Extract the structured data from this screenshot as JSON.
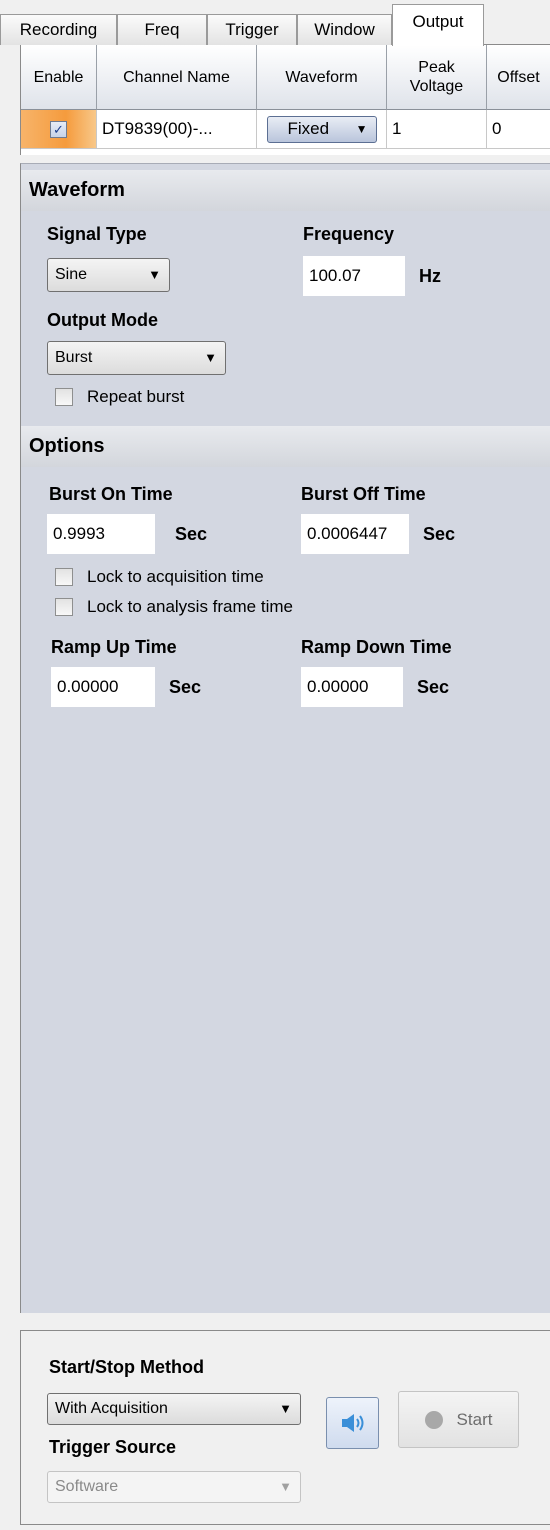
{
  "tabs": [
    {
      "label": "Recording"
    },
    {
      "label": "Freq"
    },
    {
      "label": "Trigger"
    },
    {
      "label": "Window"
    },
    {
      "label": "Output"
    }
  ],
  "grid": {
    "headers": {
      "enable": "Enable",
      "channel_name": "Channel Name",
      "waveform": "Waveform",
      "peak_voltage": "Peak Voltage",
      "offset": "Offset"
    },
    "row": {
      "enabled": true,
      "channel_name": "DT9839(00)-...",
      "waveform": "Fixed",
      "peak_voltage": "1",
      "offset": "0"
    }
  },
  "waveform_section": {
    "title": "Waveform",
    "signal_type_label": "Signal Type",
    "signal_type_value": "Sine",
    "frequency_label": "Frequency",
    "frequency_value": "100.07",
    "frequency_unit": "Hz",
    "output_mode_label": "Output Mode",
    "output_mode_value": "Burst",
    "repeat_burst_label": "Repeat burst"
  },
  "options_section": {
    "title": "Options",
    "burst_on_label": "Burst On Time",
    "burst_on_value": "0.9993",
    "burst_off_label": "Burst Off Time",
    "burst_off_value": "0.0006447",
    "sec_unit": "Sec",
    "lock_acq_label": "Lock to acquisition time",
    "lock_frame_label": "Lock to analysis frame time",
    "ramp_up_label": "Ramp Up Time",
    "ramp_up_value": "0.00000",
    "ramp_down_label": "Ramp Down Time",
    "ramp_down_value": "0.00000"
  },
  "bottom": {
    "start_stop_label": "Start/Stop Method",
    "start_stop_value": "With Acquisition",
    "trigger_source_label": "Trigger Source",
    "trigger_source_value": "Software",
    "start_button_label": "Start"
  },
  "colors": {
    "accent": "#f59b3d",
    "panel": "#d3d7e1",
    "speaker": "#3a8fd8"
  }
}
